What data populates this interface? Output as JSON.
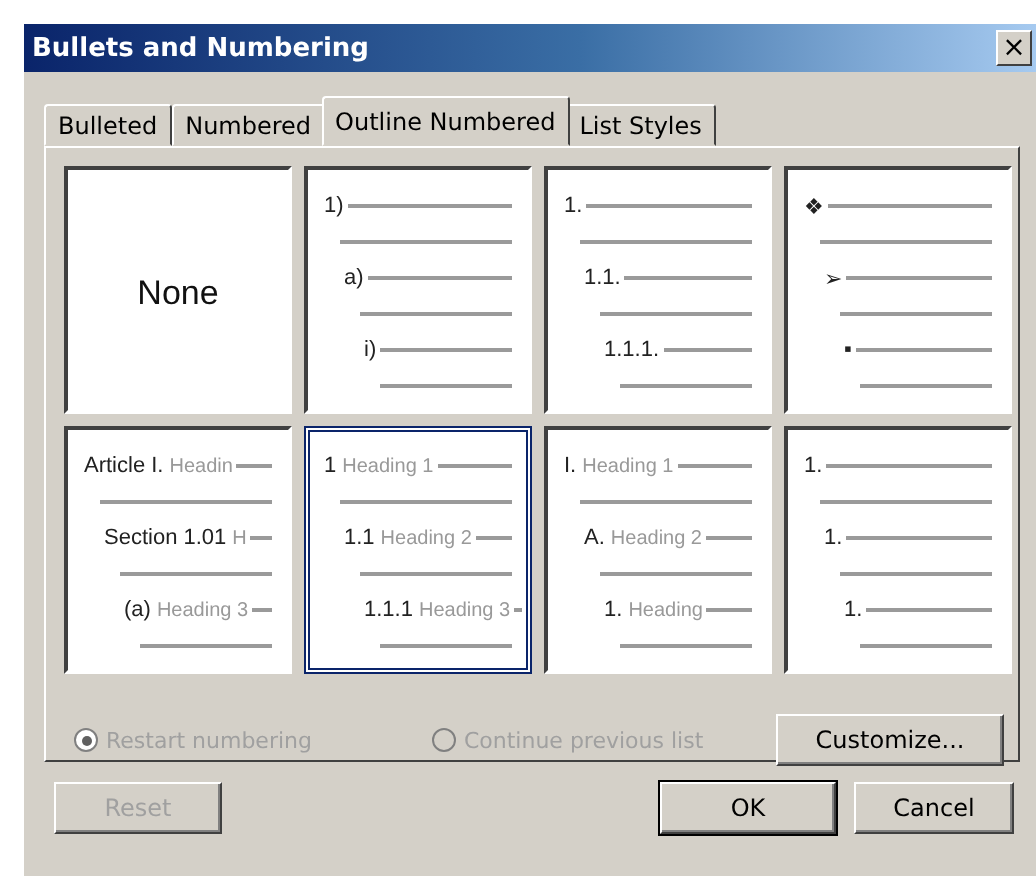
{
  "window": {
    "title": "Bullets and Numbering",
    "close": "×"
  },
  "tabs": [
    {
      "label": "Bulleted",
      "selected": false
    },
    {
      "label": "Numbered",
      "selected": false
    },
    {
      "label": "Outline Numbered",
      "selected": true
    },
    {
      "label": "List Styles",
      "selected": false
    }
  ],
  "styles": [
    {
      "kind": "none",
      "label": "None",
      "selected": false
    },
    {
      "kind": "levels",
      "selected": false,
      "levels": [
        {
          "number": "1)"
        },
        {
          "number": "a)"
        },
        {
          "number": "i)"
        }
      ]
    },
    {
      "kind": "levels",
      "selected": false,
      "levels": [
        {
          "number": "1."
        },
        {
          "number": "1.1."
        },
        {
          "number": "1.1.1."
        }
      ]
    },
    {
      "kind": "levels",
      "selected": false,
      "levels": [
        {
          "number": "❖"
        },
        {
          "number": "➢"
        },
        {
          "number": "▪"
        }
      ]
    },
    {
      "kind": "levels",
      "selected": false,
      "levels": [
        {
          "number": "Article I.",
          "heading": "Headin"
        },
        {
          "number": "Section 1.01",
          "heading": "H"
        },
        {
          "number": "(a)",
          "heading": "Heading 3"
        }
      ]
    },
    {
      "kind": "levels",
      "selected": true,
      "levels": [
        {
          "number": "1",
          "heading": "Heading 1"
        },
        {
          "number": "1.1",
          "heading": "Heading 2"
        },
        {
          "number": "1.1.1",
          "heading": "Heading 3"
        }
      ]
    },
    {
      "kind": "levels",
      "selected": false,
      "levels": [
        {
          "number": "I.",
          "heading": "Heading 1"
        },
        {
          "number": "A.",
          "heading": "Heading 2"
        },
        {
          "number": "1.",
          "heading": "Heading"
        }
      ]
    },
    {
      "kind": "levels",
      "selected": false,
      "levels": [
        {
          "number": "1."
        },
        {
          "number": "1."
        },
        {
          "number": "1."
        }
      ]
    }
  ],
  "numbering": [
    {
      "label": "Restart numbering",
      "selected": true,
      "disabled": true
    },
    {
      "label": "Continue previous list",
      "selected": false,
      "disabled": true
    }
  ],
  "customize_button": "Customize...",
  "buttons": [
    {
      "label": "Reset",
      "disabled": true,
      "default": false
    },
    {
      "label": "OK",
      "disabled": false,
      "default": true
    },
    {
      "label": "Cancel",
      "disabled": false,
      "default": false
    }
  ]
}
